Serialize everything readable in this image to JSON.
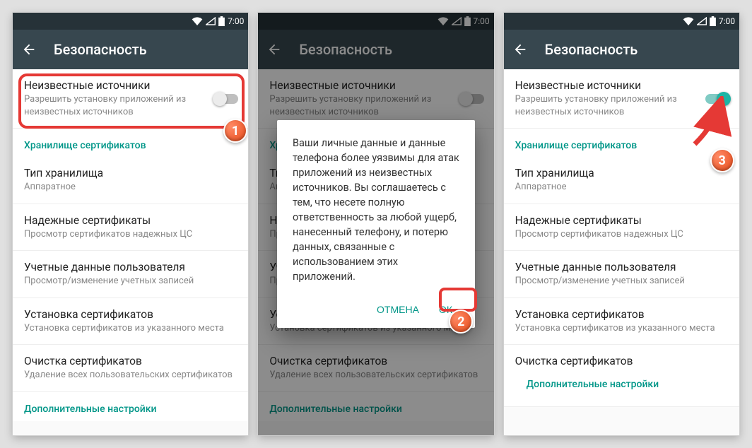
{
  "statusbar": {
    "time": "7:00"
  },
  "appbar": {
    "title": "Безопасность"
  },
  "colors": {
    "accent": "#009688",
    "danger": "#e53935",
    "badge": "#ff5722"
  },
  "rows": {
    "unknown": {
      "title": "Неизвестные источники",
      "sub": "Разрешить установку приложений из неизвестных источников"
    },
    "certstore_header": "Хранилище сертификатов",
    "storage_type": {
      "title": "Тип хранилища",
      "sub": "Аппаратное"
    },
    "trusted": {
      "title": "Надежные сертификаты",
      "sub": "Просмотр сертификатов надежных ЦС"
    },
    "usercreds": {
      "title": "Учетные данные пользователя",
      "sub": "Просмотр/изменение учетных записей"
    },
    "install": {
      "title": "Установка сертификатов",
      "sub": "Установка сертификатов из указанного места"
    },
    "clear": {
      "title": "Очистка сертификатов",
      "sub": "Удаление всех пользовательских сертификатов"
    },
    "advanced_header": "Дополнительные настройки"
  },
  "dialog": {
    "text": "Ваши личные данные и данные телефона более уязвимы для атак приложений из неизвестных источников. Вы соглашаетесь с тем, что несете полную ответственность за любой ущерб, нанесенный телефону, и потерю данных, связанные с использованием этих приложений.",
    "cancel": "ОТМЕНА",
    "ok": "ОК"
  },
  "annotations": {
    "step1": "1",
    "step2": "2",
    "step3": "3"
  },
  "screens": [
    {
      "id": "s1",
      "toggle_on": false,
      "show_dialog": false
    },
    {
      "id": "s2",
      "toggle_on": false,
      "show_dialog": true
    },
    {
      "id": "s3",
      "toggle_on": true,
      "show_dialog": false
    }
  ]
}
